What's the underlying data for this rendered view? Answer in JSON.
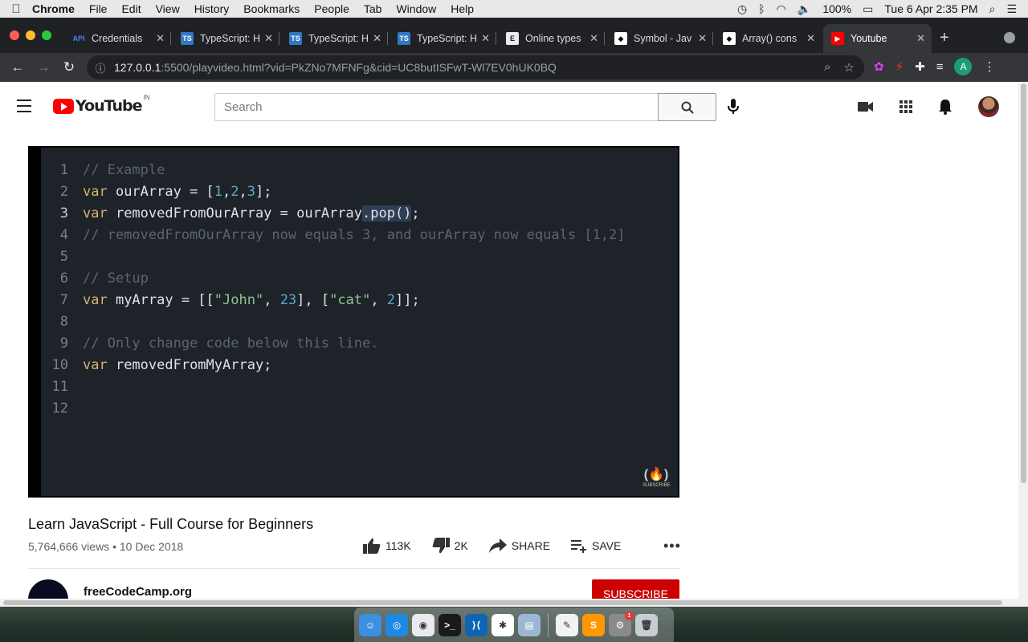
{
  "menubar": {
    "apple": "",
    "app": "Chrome",
    "items": [
      "File",
      "Edit",
      "View",
      "History",
      "Bookmarks",
      "People",
      "Tab",
      "Window",
      "Help"
    ],
    "battery": "100%",
    "datetime": "Tue 6 Apr  2:35 PM"
  },
  "tabs": [
    {
      "title": "Credentials",
      "favicon": "API",
      "fav_color": "#4285f4",
      "fav_bg": "transparent"
    },
    {
      "title": "TypeScript: H",
      "favicon": "TS",
      "fav_color": "#ffffff",
      "fav_bg": "#3178c6"
    },
    {
      "title": "TypeScript: H",
      "favicon": "TS",
      "fav_color": "#ffffff",
      "fav_bg": "#3178c6"
    },
    {
      "title": "TypeScript: H",
      "favicon": "TS",
      "fav_color": "#ffffff",
      "fav_bg": "#3178c6"
    },
    {
      "title": "Online types",
      "favicon": "E",
      "fav_color": "#222222",
      "fav_bg": "#e8eaed"
    },
    {
      "title": "Symbol - Jav",
      "favicon": "◆",
      "fav_color": "#000000",
      "fav_bg": "#ffffff"
    },
    {
      "title": "Array() cons",
      "favicon": "◆",
      "fav_color": "#000000",
      "fav_bg": "#ffffff"
    },
    {
      "title": "Youtube",
      "favicon": "▶",
      "fav_color": "#ffffff",
      "fav_bg": "#ff0000",
      "active": true
    }
  ],
  "omnibox": {
    "host": "127.0.0.1",
    "rest": ":5500/playvideo.html?vid=PkZNo7MFNFg&cid=UC8butISFwT-Wl7EV0hUK0BQ"
  },
  "profile_initial": "A",
  "youtube": {
    "region": "IN",
    "logo_text": "YouTube",
    "search_placeholder": "Search"
  },
  "code_lines": [
    {
      "n": "1",
      "parts": [
        {
          "t": "// Example",
          "c": "comment"
        }
      ]
    },
    {
      "n": "2",
      "parts": [
        {
          "t": "var",
          "c": "kw"
        },
        {
          "t": " ourArray = [",
          "c": "id"
        },
        {
          "t": "1",
          "c": "num"
        },
        {
          "t": ",",
          "c": "id"
        },
        {
          "t": "2",
          "c": "num"
        },
        {
          "t": ",",
          "c": "id"
        },
        {
          "t": "3",
          "c": "num"
        },
        {
          "t": "];",
          "c": "id"
        }
      ]
    },
    {
      "n": "3",
      "cur": true,
      "parts": [
        {
          "t": "var",
          "c": "kw"
        },
        {
          "t": " removedFromOurArray = ourArray",
          "c": "id"
        },
        {
          "t": ".pop()",
          "c": "id sel"
        },
        {
          "t": ";",
          "c": "id"
        }
      ]
    },
    {
      "n": "4",
      "parts": [
        {
          "t": "// removedFromOurArray now equals 3, and ourArray now equals [1,2]",
          "c": "comment"
        }
      ]
    },
    {
      "n": "5",
      "parts": []
    },
    {
      "n": "6",
      "parts": [
        {
          "t": "// Setup",
          "c": "comment"
        }
      ]
    },
    {
      "n": "7",
      "parts": [
        {
          "t": "var",
          "c": "kw"
        },
        {
          "t": " myArray = [[",
          "c": "id"
        },
        {
          "t": "\"John\"",
          "c": "str"
        },
        {
          "t": ", ",
          "c": "id"
        },
        {
          "t": "23",
          "c": "num"
        },
        {
          "t": "], [",
          "c": "id"
        },
        {
          "t": "\"cat\"",
          "c": "str"
        },
        {
          "t": ", ",
          "c": "id"
        },
        {
          "t": "2",
          "c": "num"
        },
        {
          "t": "]];",
          "c": "id"
        }
      ]
    },
    {
      "n": "8",
      "parts": []
    },
    {
      "n": "9",
      "parts": [
        {
          "t": "// Only change code below this line.",
          "c": "comment"
        }
      ]
    },
    {
      "n": "10",
      "parts": [
        {
          "t": "var",
          "c": "kw"
        },
        {
          "t": " removedFromMyArray;",
          "c": "id"
        }
      ]
    },
    {
      "n": "11",
      "parts": []
    },
    {
      "n": "12",
      "parts": []
    }
  ],
  "watermark": {
    "logo": "(🔥)",
    "label": "SUBSCRIBE"
  },
  "video": {
    "title": "Learn JavaScript - Full Course for Beginners",
    "views": "5,764,666 views",
    "date": "10 Dec 2018",
    "likes": "113K",
    "dislikes": "2K",
    "share": "SHARE",
    "save": "SAVE",
    "more": "•••"
  },
  "channel": {
    "name": "freeCodeCamp.org",
    "subscribe": "SUBSCRIBE"
  },
  "dock": [
    {
      "name": "finder",
      "bg": "#3d8fe0",
      "glyph": "☺"
    },
    {
      "name": "safari",
      "bg": "#1e88e5",
      "glyph": "◎"
    },
    {
      "name": "chrome",
      "bg": "#e8eaed",
      "glyph": "◉"
    },
    {
      "name": "terminal",
      "bg": "#1a1a1a",
      "glyph": ">_"
    },
    {
      "name": "vscode",
      "bg": "#0e65b4",
      "glyph": "⟩⟨"
    },
    {
      "name": "slack",
      "bg": "#ffffff",
      "glyph": "✱"
    },
    {
      "name": "preview",
      "bg": "#9bb7d4",
      "glyph": "▤"
    },
    {
      "name": "sep"
    },
    {
      "name": "notes",
      "bg": "#f2f2f2",
      "glyph": "✎"
    },
    {
      "name": "sublime",
      "bg": "#ff9800",
      "glyph": "S"
    },
    {
      "name": "system-preferences",
      "bg": "#8a8a8a",
      "glyph": "⚙",
      "badge": "1"
    },
    {
      "name": "trash",
      "bg": "#c7cdd2",
      "glyph": "🗑"
    }
  ]
}
